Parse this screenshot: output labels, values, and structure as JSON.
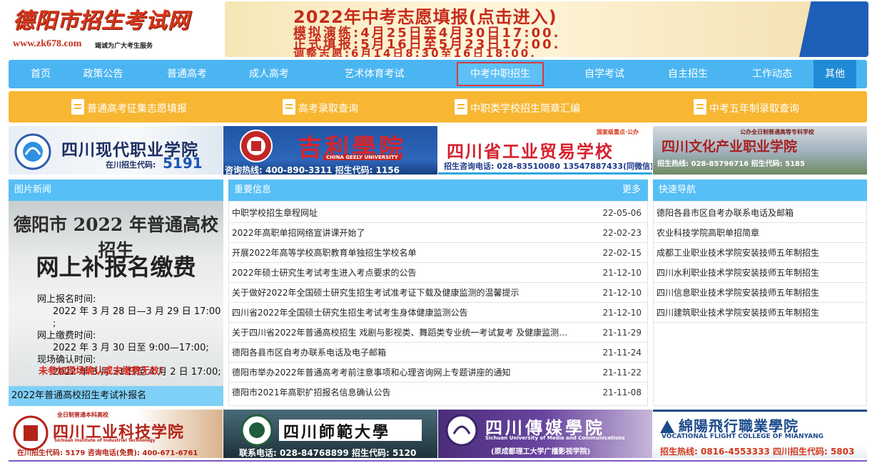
{
  "header": {
    "logo_title": "德阳市招生考试网",
    "logo_url": "www.zk678.com",
    "logo_slogan": "竭诚为广大考生服务",
    "banner_title": "2022年中考志愿填报(点击进入)",
    "banner_lines": [
      "模拟演练:4月25日至4月30日17:00.",
      "正式填报:5月16日至5月23日17:00.",
      "调整志愿:6月14日8:30至16日18:00."
    ]
  },
  "nav": [
    {
      "label": "首页"
    },
    {
      "label": "政策公告"
    },
    {
      "label": "普通高考"
    },
    {
      "label": "成人高考"
    },
    {
      "label": "艺术体育考试"
    },
    {
      "label": "中考中职招生"
    },
    {
      "label": "自学考试"
    },
    {
      "label": "自主招生"
    },
    {
      "label": "工作动态"
    },
    {
      "label": "其他"
    }
  ],
  "subnav": [
    {
      "label": "普通高考征集志愿填报",
      "icon": "document-icon"
    },
    {
      "label": "高考录取查询",
      "icon": "document-icon"
    },
    {
      "label": "中职类学校招生简章汇编",
      "icon": "document-icon"
    },
    {
      "label": "中考五年制录取查询",
      "icon": "document-icon"
    }
  ],
  "ads_top": [
    {
      "name": "四川现代职业学院",
      "sub": "在川招生代码:",
      "code": "5191"
    },
    {
      "name": "吉利學院",
      "en": "CHINA GEELY UNIVERSITY",
      "sub": "咨询热线: 400-890-3311  招生代码: 1156"
    },
    {
      "name": "四川省工业贸易学校",
      "tag": "国家级重点·公办",
      "sub": "招生咨询电话: 028-83510080  13547887433(同微信)"
    },
    {
      "name": "四川文化产业职业学院",
      "tag": "公办全日制普通高等专科学校",
      "sub": "招生热线: 028-85796716  招生代码: 5185"
    }
  ],
  "panels": {
    "photo_news_title": "图片新闻",
    "photo_news": {
      "title1": "德阳市 2022 年普通高校招生",
      "title2": "网上补报名缴费",
      "lines": [
        "网上报名时间:",
        "2022 年 3 月 28 日—3 月 29 日 17:00 ;",
        "网上缴费时间:",
        "2022 年 3 月 30 日至 9:00—17:00;",
        "现场确认时间:",
        "2022 年 3 月 31 日至 4 月 2 日 17:00;"
      ],
      "warning": "未参加现场确认或未缴费无效！",
      "caption": "2022年普通高校招生考试补报名"
    },
    "important_title": "重要信息",
    "more_label": "更多",
    "important": [
      {
        "title": "中职学校招生章程网址",
        "date": "22-05-06"
      },
      {
        "title": "2022年高职单招网络宣讲课开始了",
        "date": "22-02-23"
      },
      {
        "title": "开展2022年高等学校高职教育单独招生学校名单",
        "date": "22-02-15"
      },
      {
        "title": "2022年硕士研究生考试考生进入考点要求的公告",
        "date": "21-12-10"
      },
      {
        "title": "关于做好2022年全国硕士研究生招生考试准考证下载及健康监测的温馨提示",
        "date": "21-12-10"
      },
      {
        "title": "四川省2022年全国硕士研究生招生考试考生身体健康监测公告",
        "date": "21-12-10"
      },
      {
        "title": "关于四川省2022年普通高校招生 戏剧与影视类、舞蹈类专业统一考试复考 及健康监测…",
        "date": "21-11-29"
      },
      {
        "title": "德阳各县市区自考办联系电话及电子邮箱",
        "date": "21-11-24"
      },
      {
        "title": "德阳市举办2022年普通高考考前注意事项和心理咨询网上专题讲座的通知",
        "date": "21-11-22"
      },
      {
        "title": "德阳市2021年高职扩招报名信息确认公告",
        "date": "21-11-08"
      }
    ],
    "quicknav_title": "快速导航",
    "quicknav": [
      {
        "title": "德阳各县市区自考办联系电话及邮箱"
      },
      {
        "title": "农业科技学院高职单招简章"
      },
      {
        "title": "成都工业职业技术学院安装技师五年制招生"
      },
      {
        "title": "四川水利职业技术学院安装技师五年制招生"
      },
      {
        "title": "四川信息职业技术学院安装技师五年制招生"
      },
      {
        "title": "四川建筑职业技术学院安装技师五年制招生"
      }
    ]
  },
  "ads_bottom": [
    {
      "name": "四川工业科技学院",
      "tag": "全日制普通本科高校",
      "en": "Sichuan Institute of Industrial Technology",
      "sub": "在川招生代码: 5179  咨询电话(免费): 400-671-6761"
    },
    {
      "name": "四川師範大學",
      "sub": "联系电话: 028-84768899  招生代码: 5120"
    },
    {
      "name": "四川傳媒學院",
      "en": "Sichuan University of Media and Communications",
      "sub": "(原成都理工大学广播影视学院)"
    },
    {
      "name": "綿陽飛行職業學院",
      "en": "VOCATIONAL FLIGHT COLLEGE OF MIANYANG",
      "sub": "招生热线: 0816-4553333  四川招生代码: 5803"
    }
  ],
  "colors": {
    "nav_blue": "#4bb5f2",
    "subnav_yellow": "#f7b733",
    "accent_red": "#d6361a",
    "panel_head": "#56bff5"
  }
}
